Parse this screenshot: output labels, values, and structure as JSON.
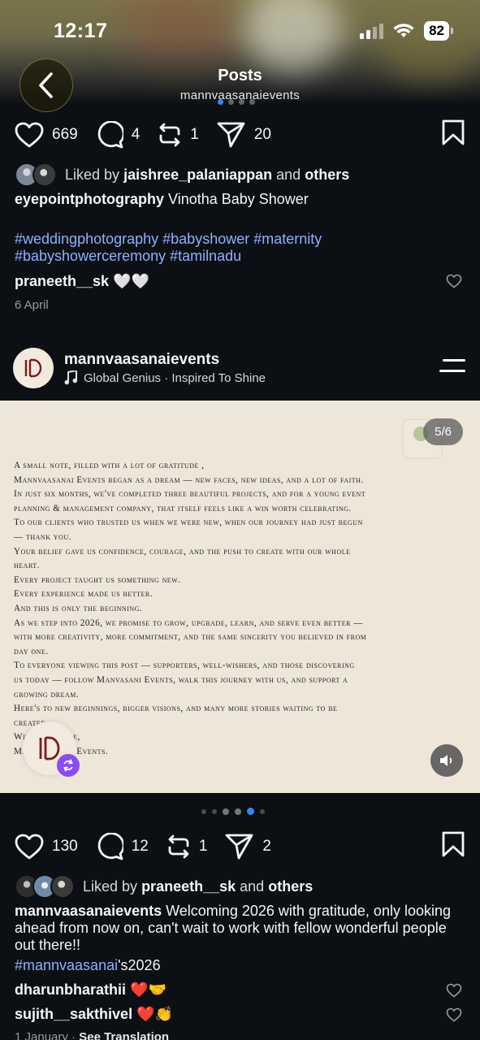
{
  "status_bar": {
    "time": "12:17",
    "battery": "82"
  },
  "header": {
    "title": "Posts",
    "subtitle": "mannvaasanaievents"
  },
  "post1": {
    "likes": "669",
    "comments": "4",
    "reposts": "1",
    "shares": "20",
    "liked_prefix": "Liked by",
    "liked_user": "jaishree_palaniappan",
    "liked_and": "and",
    "liked_others": "others",
    "caption_user": "eyepointphotography",
    "caption_text": "Vinotha Baby Shower",
    "hashtags_line1": "#weddingphotography #babyshower #maternity",
    "hashtags_line2": "#babyshowerceremony #tamilnadu",
    "comment_user": "praneeth__sk",
    "comment_text": "🤍🤍",
    "date": "6 April"
  },
  "post2": {
    "username": "mannvaasanaievents",
    "music": "Global Genius · Inspired To Shine",
    "slide_counter": "5/6",
    "note_lines": [
      "A small note, filled with a lot of gratitude ,",
      "Mannvaasanai Events began as a dream — new faces, new ideas, and a lot of faith.",
      "In just six months, we've completed three beautiful projects, and for a young event",
      "planning & management company, that itself feels like a win worth celebrating.",
      "To our clients who trusted us when we were new, when our journey had just begun",
      "— thank you.",
      "Your belief gave us confidence, courage, and the push to create with our whole",
      "heart.",
      "Every project taught us something new.",
      "Every experience made us better.",
      "And this is only the beginning.",
      "As we step into 2026, we promise to grow, upgrade, learn, and serve even better —",
      "with more creativity, more commitment, and the same sincerity you believed in from",
      "day one.",
      "To everyone viewing this post — supporters, well-wishers, and those discovering",
      "us today — follow Manvasani Events, walk this journey with us, and support a",
      "growing dream.",
      "Here's to new beginnings, bigger visions, and many more stories waiting to be",
      "created.",
      "With gratitude,",
      "Mannvaasanai Events."
    ],
    "likes": "130",
    "comments": "12",
    "reposts": "1",
    "shares": "2",
    "liked_prefix": "Liked by",
    "liked_user": "praneeth__sk",
    "liked_and": "and",
    "liked_others": "others",
    "caption_user": "mannvaasanaievents",
    "caption_text": "Welcoming 2026 with gratitude, only looking ahead from now on, can't wait to work with fellow wonderful people out there!!",
    "caption_hashtag": "#mannvaasanai",
    "caption_suffix": "'s2026",
    "comments_list": [
      {
        "user": "dharunbharathii",
        "text": "❤️🤝"
      },
      {
        "user": "sujith__sakthivel",
        "text": "❤️👏"
      }
    ],
    "date": "1 January",
    "see_translation": "See Translation"
  },
  "colors": {
    "background": "#0c1014",
    "hashtag": "#8fb0ff",
    "accent": "#3b82f6",
    "repost_badge": "#8a4bf0"
  }
}
